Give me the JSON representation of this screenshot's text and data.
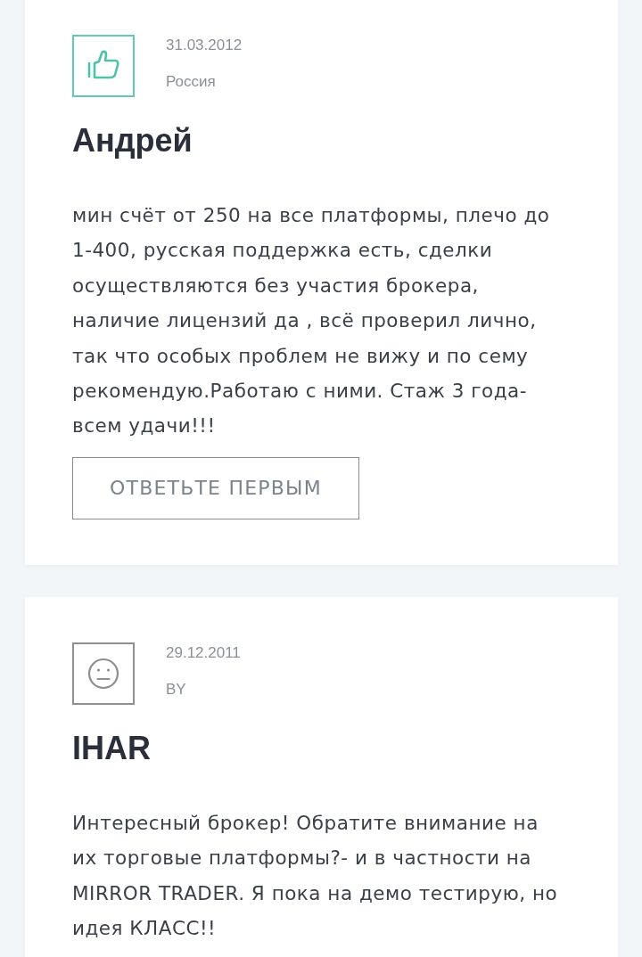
{
  "reviews": [
    {
      "kind": "positive",
      "date": "31.03.2012",
      "country": "Россия",
      "author": "Андрей",
      "text": "мин счёт от 250 на все платформы, плечо до 1-400, русская поддержка есть, сделки осуществляются без участия брокера, наличие лицензий да , всё проверил лично, так что особых проблем не вижу и по сему рекомендую.Работаю с ними. Стаж 3 года- всем удачи!!!",
      "reply_button": "ОТВЕТЬТЕ ПЕРВЫМ"
    },
    {
      "kind": "neutral",
      "date": "29.12.2011",
      "country": "BY",
      "author": "IHAR",
      "text": "Интересный брокер! Обратите внимание на их торговые платформы?- и в частности на MIRROR TRADER. Я пока на демо тестирую, но идея КЛАСС!!"
    }
  ]
}
